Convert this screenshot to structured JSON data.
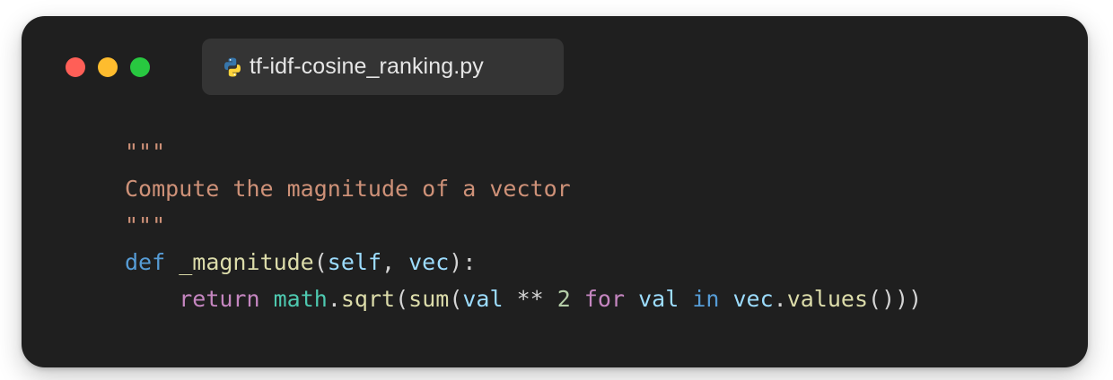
{
  "window": {
    "controls": [
      "close",
      "minimize",
      "maximize"
    ],
    "colors": {
      "close": "#ff5f57",
      "minimize": "#febc2e",
      "maximize": "#28c840",
      "background": "#1f1f1f",
      "tab": "#343434"
    }
  },
  "tab": {
    "icon": "python-icon",
    "filename": "tf-idf-cosine_ranking.py"
  },
  "code": {
    "language": "python",
    "lines": [
      {
        "tokens": [
          {
            "t": "\"\"\"",
            "c": "str"
          }
        ]
      },
      {
        "tokens": [
          {
            "t": "Compute the magnitude of a vector",
            "c": "str"
          }
        ]
      },
      {
        "tokens": [
          {
            "t": "\"\"\"",
            "c": "str"
          }
        ]
      },
      {
        "tokens": [
          {
            "t": "def",
            "c": "kw"
          },
          {
            "t": " ",
            "c": "pun"
          },
          {
            "t": "_magnitude",
            "c": "fn"
          },
          {
            "t": "(",
            "c": "pun"
          },
          {
            "t": "self",
            "c": "var"
          },
          {
            "t": ", ",
            "c": "pun"
          },
          {
            "t": "vec",
            "c": "var"
          },
          {
            "t": "):",
            "c": "pun"
          }
        ]
      },
      {
        "tokens": [
          {
            "t": "    ",
            "c": "pun"
          },
          {
            "t": "return",
            "c": "ctl"
          },
          {
            "t": " ",
            "c": "pun"
          },
          {
            "t": "math",
            "c": "cls"
          },
          {
            "t": ".",
            "c": "pun"
          },
          {
            "t": "sqrt",
            "c": "fn"
          },
          {
            "t": "(",
            "c": "pun"
          },
          {
            "t": "sum",
            "c": "fn"
          },
          {
            "t": "(",
            "c": "pun"
          },
          {
            "t": "val",
            "c": "var"
          },
          {
            "t": " ** ",
            "c": "pun"
          },
          {
            "t": "2",
            "c": "num"
          },
          {
            "t": " ",
            "c": "pun"
          },
          {
            "t": "for",
            "c": "ctl"
          },
          {
            "t": " ",
            "c": "pun"
          },
          {
            "t": "val",
            "c": "var"
          },
          {
            "t": " ",
            "c": "pun"
          },
          {
            "t": "in",
            "c": "kw"
          },
          {
            "t": " ",
            "c": "pun"
          },
          {
            "t": "vec",
            "c": "var"
          },
          {
            "t": ".",
            "c": "pun"
          },
          {
            "t": "values",
            "c": "fn"
          },
          {
            "t": "()))",
            "c": "pun"
          }
        ]
      }
    ]
  }
}
